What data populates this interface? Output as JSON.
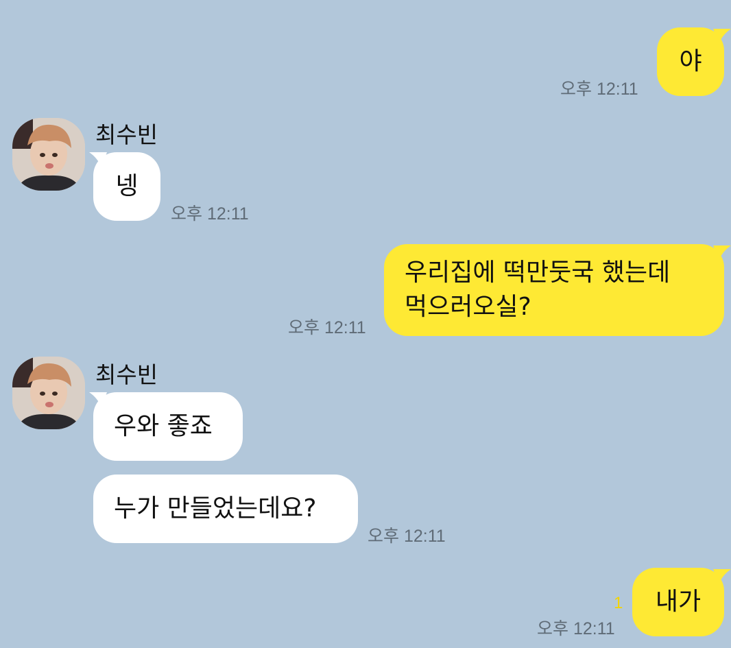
{
  "chat": {
    "messages": [
      {
        "from": "me",
        "text": "야",
        "time": "오후 12:11"
      },
      {
        "from": "them",
        "sender": "최수빈",
        "text": "넹",
        "time": "오후 12:11"
      },
      {
        "from": "me",
        "text": "우리집에 떡만둣국 했는데\n먹으러오실?",
        "time": "오후 12:11"
      },
      {
        "from": "them",
        "sender": "최수빈",
        "text": "우와 좋죠"
      },
      {
        "from": "them",
        "text": "누가 만들었는데요?",
        "time": "오후 12:11"
      },
      {
        "from": "me",
        "text": "내가",
        "time": "오후 12:11",
        "unread": "1"
      }
    ]
  },
  "colors": {
    "background": "#b2c7da",
    "my_bubble": "#fee934",
    "their_bubble": "#ffffff",
    "timestamp": "#5f6b76",
    "unread_count": "#f4d400"
  }
}
